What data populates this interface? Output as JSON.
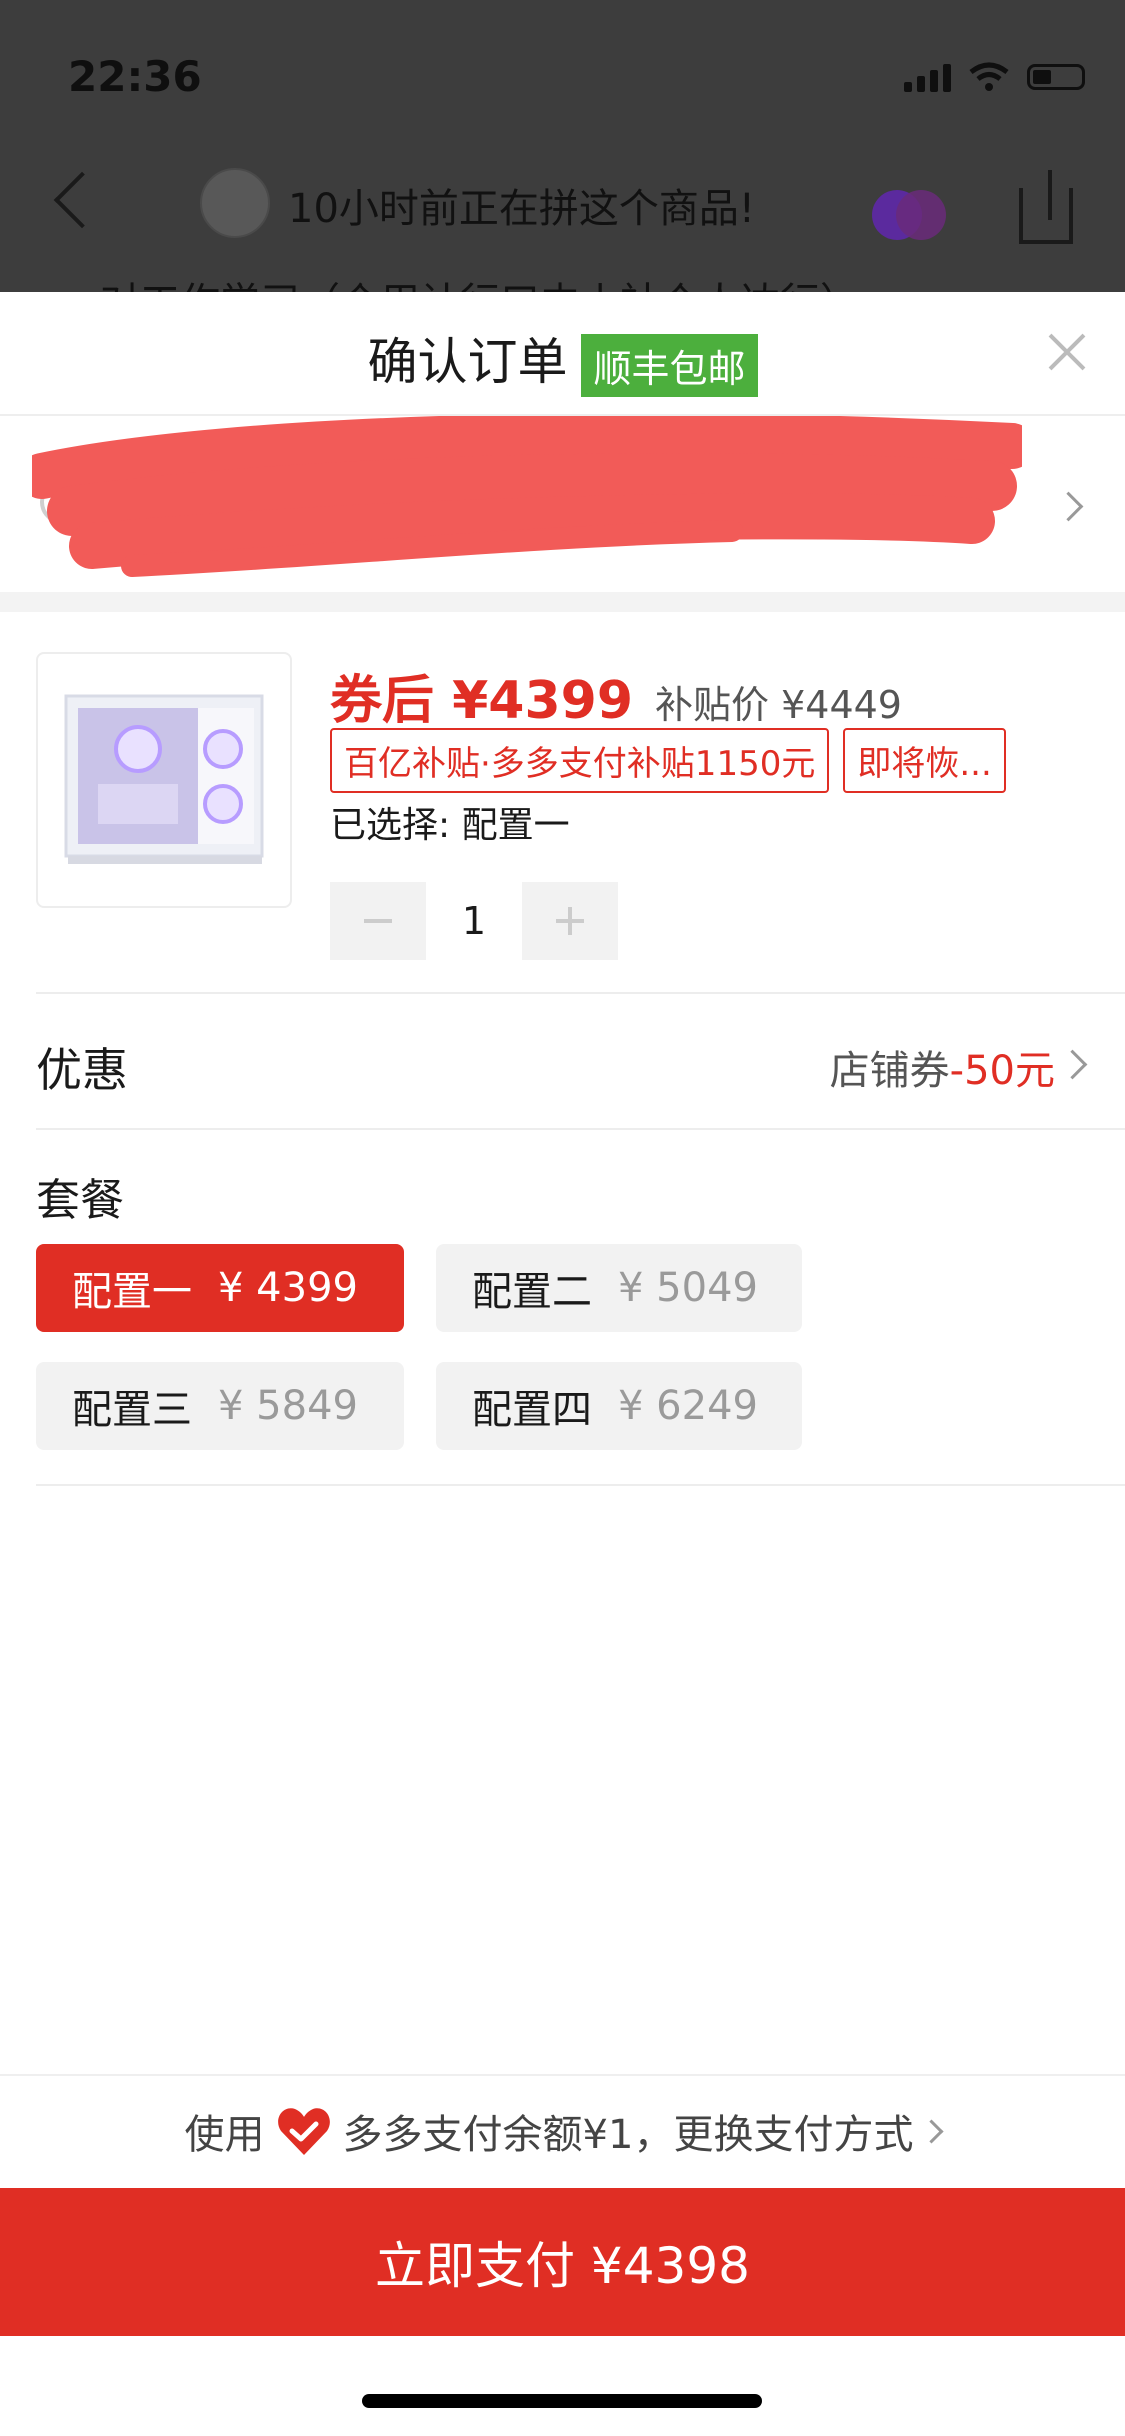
{
  "status_bar": {
    "time": "22:36"
  },
  "background_page": {
    "title": "10小时前正在拼这个商品!",
    "subtitle": "对工作学习（介用计行口内小社个人达行）"
  },
  "sheet": {
    "title": "确认订单",
    "badge": "顺丰包邮"
  },
  "product": {
    "price_main": "券后 ¥4399",
    "price_sub": "补贴价 ¥4449",
    "tags": [
      "百亿补贴·多多支付补贴1150元",
      "即将恢..."
    ],
    "selected": "已选择: 配置一",
    "quantity": "1"
  },
  "discount": {
    "label": "优惠",
    "coupon_label": "店铺券",
    "coupon_amount": "-50元"
  },
  "package": {
    "label": "套餐",
    "options": [
      {
        "name": "配置一",
        "price": "¥ 4399",
        "selected": true
      },
      {
        "name": "配置二",
        "price": "¥ 5049",
        "selected": false
      },
      {
        "name": "配置三",
        "price": "¥ 5849",
        "selected": false
      },
      {
        "name": "配置四",
        "price": "¥ 6249",
        "selected": false
      }
    ]
  },
  "payment": {
    "prefix": "使用",
    "method_text": "多多支付余额¥1，更换支付方式",
    "button_label": "立即支付 ¥4398"
  },
  "colors": {
    "accent_red": "#e02e24",
    "badge_green": "#4caf3d"
  },
  "icons": [
    "signal-icon",
    "wifi-icon",
    "battery-icon",
    "back-arrow-icon",
    "share-icon",
    "close-icon",
    "location-pin-icon",
    "chevron-right-icon",
    "minus-icon",
    "plus-icon",
    "heart-pay-icon"
  ]
}
